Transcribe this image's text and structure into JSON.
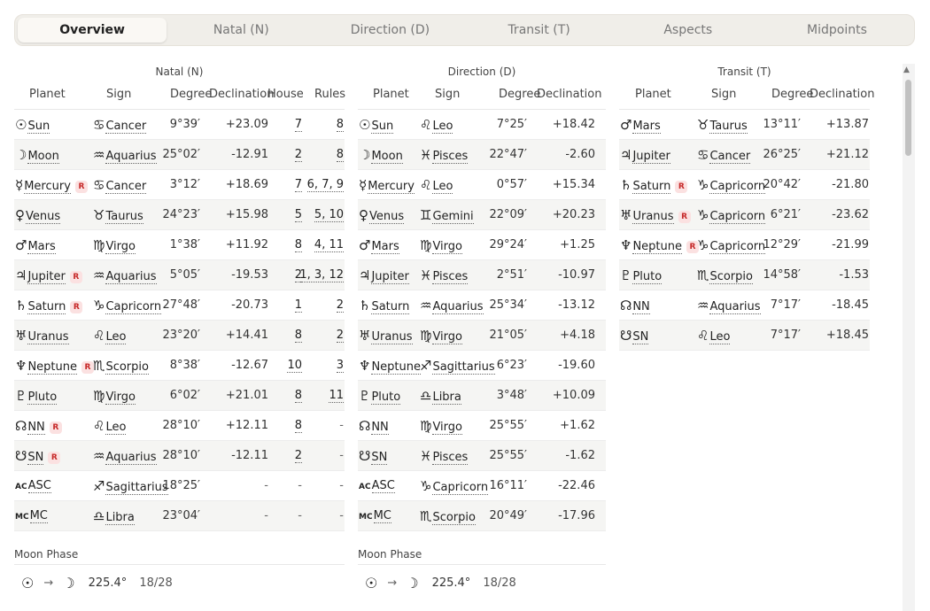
{
  "tabs": [
    {
      "label": "Overview",
      "active": true
    },
    {
      "label": "Natal (N)",
      "active": false
    },
    {
      "label": "Direction (D)",
      "active": false
    },
    {
      "label": "Transit (T)",
      "active": false
    },
    {
      "label": "Aspects",
      "active": false
    },
    {
      "label": "Midpoints",
      "active": false
    }
  ],
  "natal": {
    "title": "Natal (N)",
    "headers": {
      "planet": "Planet",
      "sign": "Sign",
      "degree": "Degree",
      "declination": "Declination",
      "house": "House",
      "rules": "Rules"
    },
    "rows": [
      {
        "glyph": "☉",
        "planet": "Sun",
        "r": false,
        "sglyph": "♋",
        "sign": "Cancer",
        "degree": "9°39′",
        "decl": "+23.09",
        "house": "7",
        "rules": "8"
      },
      {
        "glyph": "☽",
        "planet": "Moon",
        "r": false,
        "sglyph": "♒",
        "sign": "Aquarius",
        "degree": "25°02′",
        "decl": "-12.91",
        "house": "2",
        "rules": "8"
      },
      {
        "glyph": "☿",
        "planet": "Mercury",
        "r": true,
        "sglyph": "♋",
        "sign": "Cancer",
        "degree": "3°12′",
        "decl": "+18.69",
        "house": "7",
        "rules": "6, 7, 9"
      },
      {
        "glyph": "♀",
        "planet": "Venus",
        "r": false,
        "sglyph": "♉",
        "sign": "Taurus",
        "degree": "24°23′",
        "decl": "+15.98",
        "house": "5",
        "rules": "5, 10"
      },
      {
        "glyph": "♂",
        "planet": "Mars",
        "r": false,
        "sglyph": "♍",
        "sign": "Virgo",
        "degree": "1°38′",
        "decl": "+11.92",
        "house": "8",
        "rules": "4, 11"
      },
      {
        "glyph": "♃",
        "planet": "Jupiter",
        "r": true,
        "sglyph": "♒",
        "sign": "Aquarius",
        "degree": "5°05′",
        "decl": "-19.53",
        "house": "2",
        "rules": "1, 3, 12"
      },
      {
        "glyph": "♄",
        "planet": "Saturn",
        "r": true,
        "sglyph": "♑",
        "sign": "Capricorn",
        "degree": "27°48′",
        "decl": "-20.73",
        "house": "1",
        "rules": "2"
      },
      {
        "glyph": "♅",
        "planet": "Uranus",
        "r": false,
        "sglyph": "♌",
        "sign": "Leo",
        "degree": "23°20′",
        "decl": "+14.41",
        "house": "8",
        "rules": "2"
      },
      {
        "glyph": "♆",
        "planet": "Neptune",
        "r": true,
        "sglyph": "♏",
        "sign": "Scorpio",
        "degree": "8°38′",
        "decl": "-12.67",
        "house": "10",
        "rules": "3"
      },
      {
        "glyph": "♇",
        "planet": "Pluto",
        "r": false,
        "sglyph": "♍",
        "sign": "Virgo",
        "degree": "6°02′",
        "decl": "+21.01",
        "house": "8",
        "rules": "11"
      },
      {
        "glyph": "☊",
        "planet": "NN",
        "r": true,
        "sglyph": "♌",
        "sign": "Leo",
        "degree": "28°10′",
        "decl": "+12.11",
        "house": "8",
        "rules": "-"
      },
      {
        "glyph": "☋",
        "planet": "SN",
        "r": true,
        "sglyph": "♒",
        "sign": "Aquarius",
        "degree": "28°10′",
        "decl": "-12.11",
        "house": "2",
        "rules": "-"
      },
      {
        "glyph": "AC",
        "planet": "ASC",
        "r": false,
        "sglyph": "♐",
        "sign": "Sagittarius",
        "degree": "18°25′",
        "decl": "-",
        "house": "-",
        "rules": "-"
      },
      {
        "glyph": "MC",
        "planet": "MC",
        "r": false,
        "sglyph": "♎",
        "sign": "Libra",
        "degree": "23°04′",
        "decl": "-",
        "house": "-",
        "rules": "-"
      }
    ],
    "moon_phase": {
      "title": "Moon Phase",
      "from": "☉",
      "arrow": "→",
      "to": "☽",
      "degree": "225.4°",
      "fraction": "18/28"
    }
  },
  "direction": {
    "title": "Direction (D)",
    "headers": {
      "planet": "Planet",
      "sign": "Sign",
      "degree": "Degree",
      "declination": "Declination"
    },
    "rows": [
      {
        "glyph": "☉",
        "planet": "Sun",
        "r": false,
        "sglyph": "♌",
        "sign": "Leo",
        "degree": "7°25′",
        "decl": "+18.42"
      },
      {
        "glyph": "☽",
        "planet": "Moon",
        "r": false,
        "sglyph": "♓",
        "sign": "Pisces",
        "degree": "22°47′",
        "decl": "-2.60"
      },
      {
        "glyph": "☿",
        "planet": "Mercury",
        "r": false,
        "sglyph": "♌",
        "sign": "Leo",
        "degree": "0°57′",
        "decl": "+15.34"
      },
      {
        "glyph": "♀",
        "planet": "Venus",
        "r": false,
        "sglyph": "♊",
        "sign": "Gemini",
        "degree": "22°09′",
        "decl": "+20.23"
      },
      {
        "glyph": "♂",
        "planet": "Mars",
        "r": false,
        "sglyph": "♍",
        "sign": "Virgo",
        "degree": "29°24′",
        "decl": "+1.25"
      },
      {
        "glyph": "♃",
        "planet": "Jupiter",
        "r": false,
        "sglyph": "♓",
        "sign": "Pisces",
        "degree": "2°51′",
        "decl": "-10.97"
      },
      {
        "glyph": "♄",
        "planet": "Saturn",
        "r": false,
        "sglyph": "♒",
        "sign": "Aquarius",
        "degree": "25°34′",
        "decl": "-13.12"
      },
      {
        "glyph": "♅",
        "planet": "Uranus",
        "r": false,
        "sglyph": "♍",
        "sign": "Virgo",
        "degree": "21°05′",
        "decl": "+4.18"
      },
      {
        "glyph": "♆",
        "planet": "Neptune",
        "r": false,
        "sglyph": "♐",
        "sign": "Sagittarius",
        "degree": "6°23′",
        "decl": "-19.60"
      },
      {
        "glyph": "♇",
        "planet": "Pluto",
        "r": false,
        "sglyph": "♎",
        "sign": "Libra",
        "degree": "3°48′",
        "decl": "+10.09"
      },
      {
        "glyph": "☊",
        "planet": "NN",
        "r": false,
        "sglyph": "♍",
        "sign": "Virgo",
        "degree": "25°55′",
        "decl": "+1.62"
      },
      {
        "glyph": "☋",
        "planet": "SN",
        "r": false,
        "sglyph": "♓",
        "sign": "Pisces",
        "degree": "25°55′",
        "decl": "-1.62"
      },
      {
        "glyph": "AC",
        "planet": "ASC",
        "r": false,
        "sglyph": "♑",
        "sign": "Capricorn",
        "degree": "16°11′",
        "decl": "-22.46"
      },
      {
        "glyph": "MC",
        "planet": "MC",
        "r": false,
        "sglyph": "♏",
        "sign": "Scorpio",
        "degree": "20°49′",
        "decl": "-17.96"
      }
    ],
    "moon_phase": {
      "title": "Moon Phase",
      "from": "☉",
      "arrow": "→",
      "to": "☽",
      "degree": "225.4°",
      "fraction": "18/28"
    }
  },
  "transit": {
    "title": "Transit (T)",
    "headers": {
      "planet": "Planet",
      "sign": "Sign",
      "degree": "Degree",
      "declination": "Declination"
    },
    "rows": [
      {
        "glyph": "♂",
        "planet": "Mars",
        "r": false,
        "sglyph": "♉",
        "sign": "Taurus",
        "degree": "13°11′",
        "decl": "+13.87"
      },
      {
        "glyph": "♃",
        "planet": "Jupiter",
        "r": false,
        "sglyph": "♋",
        "sign": "Cancer",
        "degree": "26°25′",
        "decl": "+21.12"
      },
      {
        "glyph": "♄",
        "planet": "Saturn",
        "r": true,
        "sglyph": "♑",
        "sign": "Capricorn",
        "degree": "20°42′",
        "decl": "-21.80"
      },
      {
        "glyph": "♅",
        "planet": "Uranus",
        "r": true,
        "sglyph": "♑",
        "sign": "Capricorn",
        "degree": "6°21′",
        "decl": "-23.62"
      },
      {
        "glyph": "♆",
        "planet": "Neptune",
        "r": true,
        "sglyph": "♑",
        "sign": "Capricorn",
        "degree": "12°29′",
        "decl": "-21.99"
      },
      {
        "glyph": "♇",
        "planet": "Pluto",
        "r": false,
        "sglyph": "♏",
        "sign": "Scorpio",
        "degree": "14°58′",
        "decl": "-1.53"
      },
      {
        "glyph": "☊",
        "planet": "NN",
        "r": false,
        "sglyph": "♒",
        "sign": "Aquarius",
        "degree": "7°17′",
        "decl": "-18.45"
      },
      {
        "glyph": "☋",
        "planet": "SN",
        "r": false,
        "sglyph": "♌",
        "sign": "Leo",
        "degree": "7°17′",
        "decl": "+18.45"
      }
    ]
  },
  "badge_label": "R"
}
